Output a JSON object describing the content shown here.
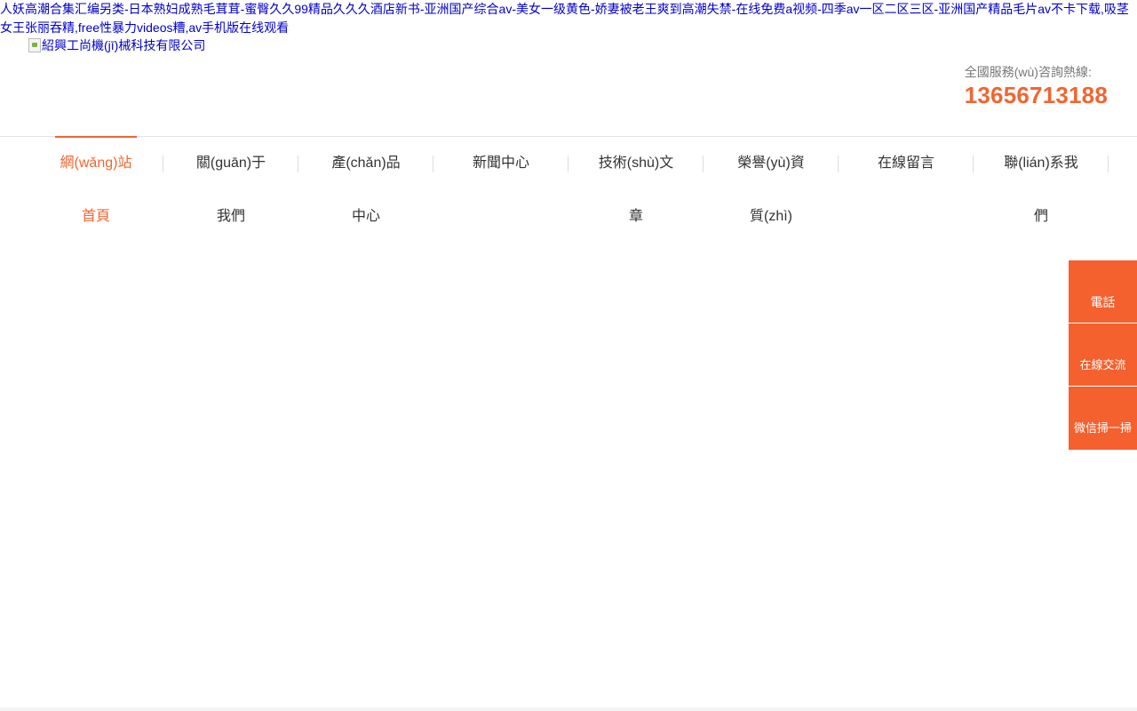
{
  "banner": {
    "text": "人妖高潮合集汇编另类-日本熟妇成熟毛茸茸-蜜臀久久99精品久久久酒店新书-亚洲国产综合av-美女一级黄色-娇妻被老王爽到高潮失禁-在线免费a视频-四季av一区二区三区-亚洲国产精品毛片av不卡下载,吸茎女王张丽吞精,free性暴力videos糟,av手机版在线观看"
  },
  "logo": {
    "alt_text": "紹興工尚機(jī)械科技有限公司"
  },
  "hotline": {
    "label": "全國服務(wù)咨詢熱線:",
    "number": "13656713188"
  },
  "nav": {
    "items": [
      {
        "line1": "網(wǎng)站",
        "line2": "首頁"
      },
      {
        "line1": "關(guān)于",
        "line2": "我們"
      },
      {
        "line1": "產(chǎn)品",
        "line2": "中心"
      },
      {
        "line1": "新聞中心",
        "line2": ""
      },
      {
        "line1": "技術(shù)文",
        "line2": "章"
      },
      {
        "line1": "榮譽(yù)資",
        "line2": "質(zhì)"
      },
      {
        "line1": "在線留言",
        "line2": ""
      },
      {
        "line1": "聯(lián)系我",
        "line2": "們"
      }
    ]
  },
  "side_float": {
    "phone_label": "電話",
    "chat_label": "在線交流",
    "wechat_label": "微信掃一掃"
  },
  "colors": {
    "accent": "#f26530",
    "side_button": "#f4602e",
    "link": "#0000cc"
  }
}
